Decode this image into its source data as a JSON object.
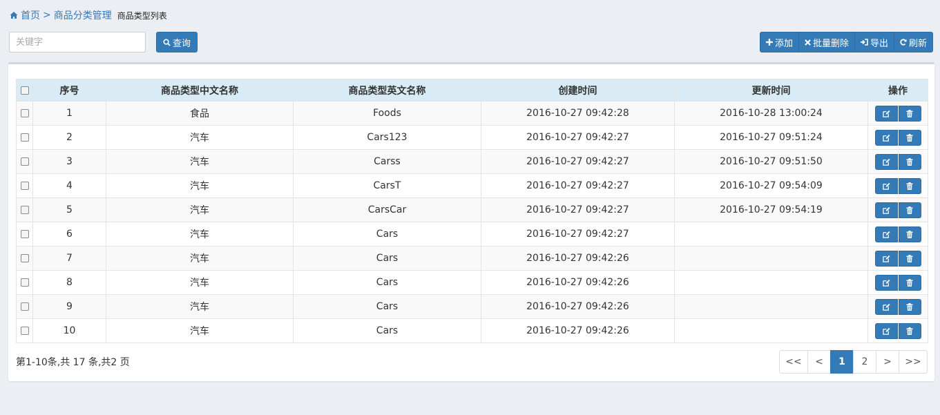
{
  "breadcrumb": {
    "home": "首页",
    "separator": ">",
    "category": "商品分类管理",
    "current": "商品类型列表"
  },
  "search": {
    "placeholder": "关键字",
    "value": "",
    "button_label": "查询",
    "button_icon": "search-icon"
  },
  "toolbar": [
    {
      "label": "添加",
      "icon": "plus-icon"
    },
    {
      "label": "批量删除",
      "icon": "x-icon"
    },
    {
      "label": "导出",
      "icon": "export-icon"
    },
    {
      "label": "刷新",
      "icon": "refresh-icon"
    }
  ],
  "table": {
    "headers": [
      "序号",
      "商品类型中文名称",
      "商品类型英文名称",
      "创建时间",
      "更新时间",
      "操作"
    ],
    "rows": [
      [
        "1",
        "食品",
        "Foods",
        "2016-10-27 09:42:28",
        "2016-10-28 13:00:24"
      ],
      [
        "2",
        "汽车",
        "Cars123",
        "2016-10-27 09:42:27",
        "2016-10-27 09:51:24"
      ],
      [
        "3",
        "汽车",
        "Carss",
        "2016-10-27 09:42:27",
        "2016-10-27 09:51:50"
      ],
      [
        "4",
        "汽车",
        "CarsT",
        "2016-10-27 09:42:27",
        "2016-10-27 09:54:09"
      ],
      [
        "5",
        "汽车",
        "CarsCar",
        "2016-10-27 09:42:27",
        "2016-10-27 09:54:19"
      ],
      [
        "6",
        "汽车",
        "Cars",
        "2016-10-27 09:42:27",
        ""
      ],
      [
        "7",
        "汽车",
        "Cars",
        "2016-10-27 09:42:26",
        ""
      ],
      [
        "8",
        "汽车",
        "Cars",
        "2016-10-27 09:42:26",
        ""
      ],
      [
        "9",
        "汽车",
        "Cars",
        "2016-10-27 09:42:26",
        ""
      ],
      [
        "10",
        "汽车",
        "Cars",
        "2016-10-27 09:42:26",
        ""
      ]
    ],
    "row_actions": [
      "edit-icon",
      "trash-icon"
    ]
  },
  "summary": "第1-10条,共 17 条,共2 页",
  "pagination": {
    "items": [
      "<<",
      "<",
      "1",
      "2",
      ">",
      ">>"
    ],
    "active": "1"
  },
  "colors": {
    "primary": "#337ab7",
    "header_bg": "#d9ebf5",
    "page_bg": "#ebeef3"
  }
}
